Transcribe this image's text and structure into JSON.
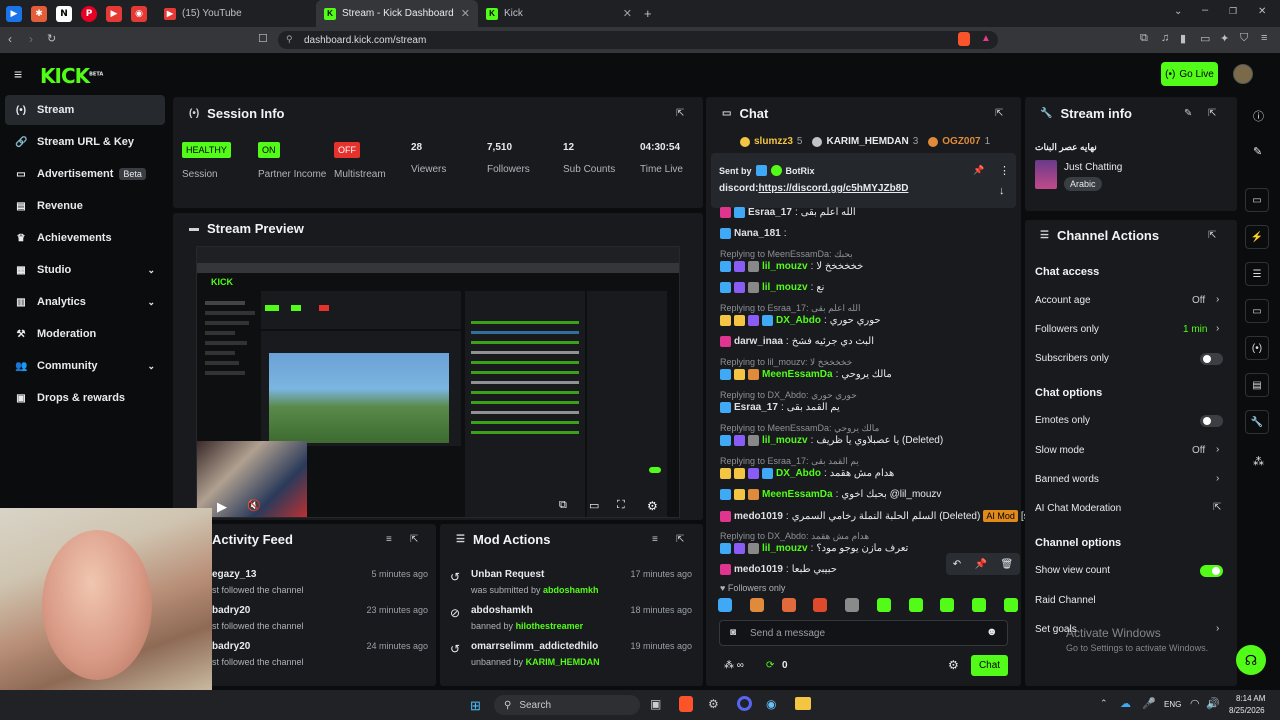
{
  "browser": {
    "tabs": [
      {
        "label": "(15) YouTube",
        "active": false
      },
      {
        "label": "Stream - Kick Dashboard",
        "active": true
      },
      {
        "label": "Kick",
        "active": false
      }
    ],
    "url": "dashboard.kick.com/stream"
  },
  "header": {
    "logo": "KICK",
    "logo_tag": "BETA",
    "go_live": "Go Live"
  },
  "sidebar": {
    "items": [
      {
        "label": "Stream",
        "icon": "broadcast-icon",
        "glyph": "(•)",
        "active": true
      },
      {
        "label": "Stream URL & Key",
        "icon": "link-icon",
        "glyph": "🔗"
      },
      {
        "label": "Advertisement",
        "icon": "monitor-icon",
        "glyph": "▭",
        "badge": "Beta"
      },
      {
        "label": "Revenue",
        "icon": "revenue-icon",
        "glyph": "▤"
      },
      {
        "label": "Achievements",
        "icon": "trophy-icon",
        "glyph": "♛"
      },
      {
        "label": "Studio",
        "icon": "studio-icon",
        "glyph": "▦",
        "chevron": true
      },
      {
        "label": "Analytics",
        "icon": "chart-icon",
        "glyph": "▥",
        "chevron": true
      },
      {
        "label": "Moderation",
        "icon": "hammer-icon",
        "glyph": "⚒"
      },
      {
        "label": "Community",
        "icon": "community-icon",
        "glyph": "👥",
        "chevron": true
      },
      {
        "label": "Drops & rewards",
        "icon": "gift-icon",
        "glyph": "▣"
      }
    ]
  },
  "session": {
    "title": "Session Info",
    "stats": [
      {
        "label": "Session",
        "pill": "HEALTHY",
        "pill_color": "#53fc18"
      },
      {
        "label": "Partner Income",
        "pill": "ON",
        "pill_color": "#53fc18"
      },
      {
        "label": "Multistream",
        "pill": "OFF",
        "pill_color": "#e5322d"
      },
      {
        "label": "Viewers",
        "value": "28"
      },
      {
        "label": "Followers",
        "value": "7,510"
      },
      {
        "label": "Sub Counts",
        "value": "12"
      },
      {
        "label": "Time Live",
        "value": "04:30:54"
      }
    ]
  },
  "preview": {
    "title": "Stream Preview"
  },
  "activity": {
    "title": "Activity Feed",
    "rows": [
      {
        "name": "egazy_13",
        "sub": "st followed the channel",
        "time": "5 minutes ago"
      },
      {
        "name": "badry20",
        "sub": "st followed the channel",
        "time": "23 minutes ago"
      },
      {
        "name": "badry20",
        "sub": "st followed the channel",
        "time": "24 minutes ago"
      }
    ]
  },
  "mod": {
    "title": "Mod Actions",
    "rows": [
      {
        "title": "Unban Request",
        "sub": "was submitted by",
        "who": "abdoshamkh",
        "time": "17 minutes ago",
        "icon": "history-icon"
      },
      {
        "title": "abdoshamkh",
        "sub": "banned by",
        "who": "hilothestreamer",
        "time": "18 minutes ago",
        "icon": "ban-icon"
      },
      {
        "title": "omarrselimm_addictedhilo",
        "sub": "unbanned by",
        "who": "KARIM_HEMDAN",
        "time": "19 minutes ago",
        "icon": "history-icon"
      }
    ]
  },
  "chat": {
    "title": "Chat",
    "top": [
      {
        "name": "slumzz3",
        "count": "5",
        "color": "#f4c542"
      },
      {
        "name": "KARIM_HEMDAN",
        "count": "3",
        "color": "#c0c4c8"
      },
      {
        "name": "OGZ007",
        "count": "1",
        "color": "#e08a3c"
      }
    ],
    "pinned": {
      "sent_by": "Sent by",
      "bot": "BotRix",
      "prefix": "discord:",
      "link": "https://discord.gg/c5hMYJZb8D"
    },
    "messages": [
      {
        "user": "Esraa_17",
        "color": "#e0e0e0",
        "text": "الله اعلم بقى",
        "badges": [
          "#e0358f",
          "#3fa9f5"
        ]
      },
      {
        "user": "Nana_181",
        "color": "#e0e0e0",
        "text": "",
        "badges": [
          "#3fa9f5"
        ]
      },
      {
        "reply": "Replying to MeenEssamDa: بحبك",
        "user": "lil_mouzv",
        "color": "#53fc18",
        "text": "خخخخخخ لا",
        "badges": [
          "#3fa9f5",
          "#8a5cf6",
          "#888"
        ]
      },
      {
        "user": "lil_mouzv",
        "color": "#53fc18",
        "text": "نع",
        "badges": [
          "#3fa9f5",
          "#8a5cf6",
          "#888"
        ]
      },
      {
        "reply": "Replying to Esraa_17: الله اعلم بقى",
        "user": "DX_Abdo",
        "color": "#53fc18",
        "text": "حوري حوري",
        "badges": [
          "#f4c542",
          "#f4c542",
          "#8a5cf6",
          "#3fa9f5"
        ]
      },
      {
        "user": "darw_inaa",
        "color": "#e0e0e0",
        "text": "البث دي جرئيه فشخ",
        "badges": [
          "#e0358f"
        ]
      },
      {
        "reply": "Replying to lil_mouzv: خخخخخخ لا",
        "user": "MeenEssamDa",
        "color": "#53fc18",
        "text": "مالك يروحي",
        "badges": [
          "#3fa9f5",
          "#f4c542",
          "#e08a3c"
        ]
      },
      {
        "reply": "Replying to DX_Abdo: حوري حوري",
        "user": "Esraa_17",
        "color": "#e0e0e0",
        "text": "يم القمد بقى",
        "badges": [
          "#3fa9f5"
        ]
      },
      {
        "reply": "Replying to MeenEssamDa: مالك يروحي",
        "user": "lil_mouzv",
        "color": "#53fc18",
        "text": "يا عصبلاوي يا ظريف (Deleted)",
        "badges": [
          "#3fa9f5",
          "#8a5cf6",
          "#888"
        ]
      },
      {
        "reply": "Replying to Esraa_17: يم القمد بقى",
        "user": "DX_Abdo",
        "color": "#53fc18",
        "text": "هدام مش هقمد",
        "badges": [
          "#f4c542",
          "#f4c542",
          "#8a5cf6",
          "#3fa9f5"
        ]
      },
      {
        "user": "MeenEssamDa",
        "color": "#53fc18",
        "text": "بحبك اخوي @lil_mouzv",
        "badges": [
          "#3fa9f5",
          "#f4c542",
          "#e08a3c"
        ]
      },
      {
        "user": "medo1019",
        "color": "#e0e0e0",
        "text": "السلم الحلبة النملة رخامي السمري (Deleted)",
        "ai": "AI Mod",
        "tag": "[sexual]",
        "badges": [
          "#e0358f"
        ]
      },
      {
        "reply": "Replying to DX_Abdo: هدام مش هقمد",
        "user": "lil_mouzv",
        "color": "#53fc18",
        "text": "تعرف مازن يوجو مود؟",
        "badges": [
          "#3fa9f5",
          "#8a5cf6",
          "#888"
        ]
      },
      {
        "user": "medo1019",
        "color": "#e0e0e0",
        "text": "حبيبي طبعا",
        "badges": [
          "#e0358f"
        ]
      }
    ],
    "followers_only": "Followers only",
    "input_placeholder": "Send a message",
    "points": "0",
    "send": "Chat"
  },
  "stream_info": {
    "title": "Stream info",
    "stream_title": "نهايه عصر البنات",
    "category": "Just Chatting",
    "language": "Arabic"
  },
  "actions": {
    "title": "Channel Actions",
    "chat_access": "Chat access",
    "account_age": "Account age",
    "account_age_val": "Off",
    "followers_only": "Followers only",
    "followers_only_val": "1 min",
    "subscribers_only": "Subscribers only",
    "chat_options": "Chat options",
    "emotes_only": "Emotes only",
    "slow_mode": "Slow mode",
    "slow_mode_val": "Off",
    "banned_words": "Banned words",
    "ai_mod": "AI Chat Moderation",
    "channel_options": "Channel options",
    "show_view_count": "Show view count",
    "raid_channel": "Raid Channel",
    "set_goals": "Set goals"
  },
  "watermark": {
    "line1": "Activate Windows",
    "line2": "Go to Settings to activate Windows."
  },
  "taskbar": {
    "search": "Search",
    "lang": "ENG",
    "time": "8:14 AM",
    "date": "8/25/2026"
  }
}
